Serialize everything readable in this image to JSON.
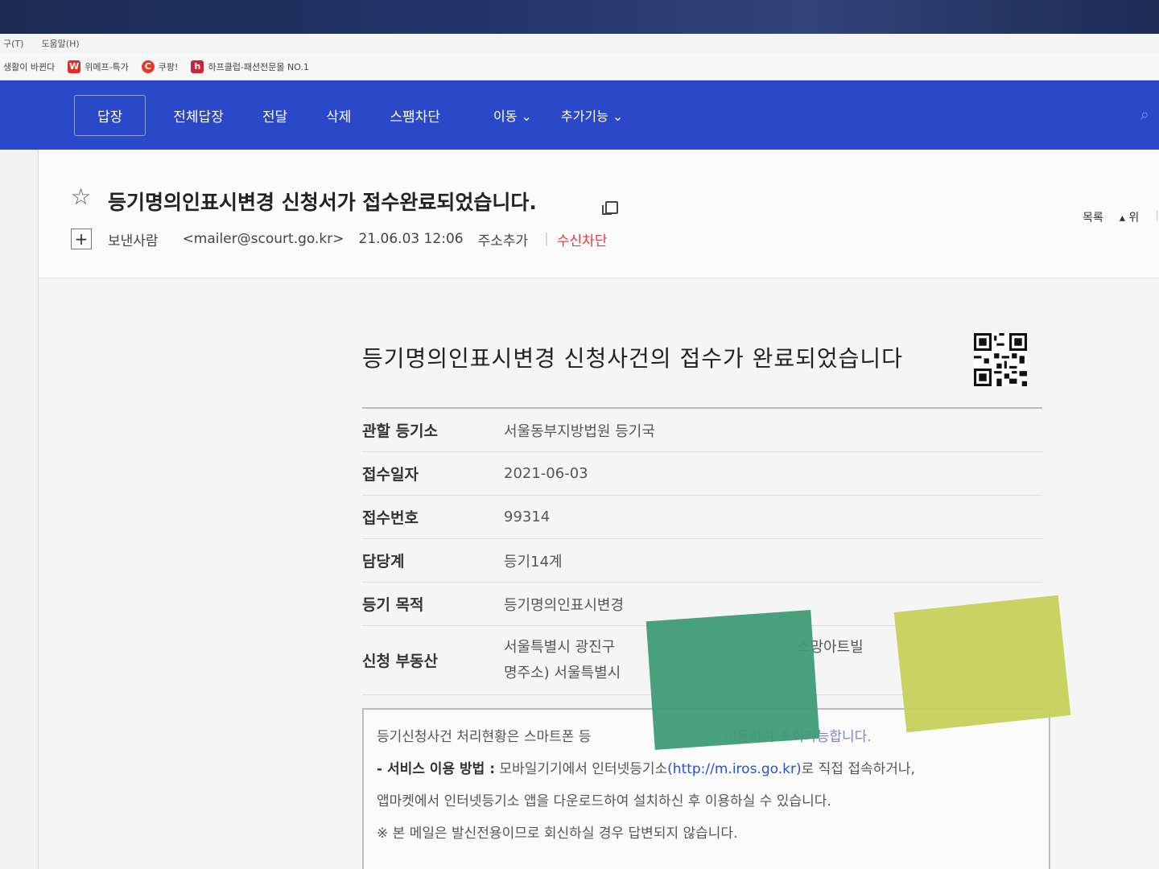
{
  "browser": {
    "menu": [
      "구(T)",
      "도움말(H)"
    ],
    "bookmarks": [
      {
        "icon": "",
        "label": "생활이 바뀐다",
        "color": ""
      },
      {
        "icon": "W",
        "label": "위메프-특가",
        "color": "#e12c2c"
      },
      {
        "icon": "C",
        "label": "쿠팡!",
        "color": "#e23a2a"
      },
      {
        "icon": "h",
        "label": "하프클럽-패션전문몰 NO.1",
        "color": "#c8263c"
      }
    ]
  },
  "toolbar": {
    "reply": "답장",
    "reply_all": "전체답장",
    "forward": "전달",
    "delete": "삭제",
    "spam": "스팸차단",
    "move": "이동 ⌄",
    "more": "추가기능 ⌄"
  },
  "mail": {
    "subject": "등기명의인표시변경 신청서가 접수완료되었습니다.",
    "sender_label": "보낸사람",
    "sender_email": "<mailer@scourt.go.kr>",
    "date": "21.06.03 12:06",
    "add_contact": "주소추가",
    "block": "수신차단",
    "list_link": "목록",
    "up_link": "▴ 위"
  },
  "body": {
    "title": "등기명의인표시변경 신청사건의 접수가 완료되었습니다",
    "rows": [
      {
        "label": "관할 등기소",
        "value": "서울동부지방법원 등기국"
      },
      {
        "label": "접수일자",
        "value": "2021-06-03"
      },
      {
        "label": "접수번호",
        "value": "99314"
      },
      {
        "label": "담당계",
        "value": "등기14계"
      },
      {
        "label": "등기 목적",
        "value": "등기명의인표시변경"
      }
    ],
    "property": {
      "label": "신청 부동산",
      "line1": "서울특별시 광진구",
      "line1_right": "소망아트빌",
      "line2": "명주소) 서울특별시"
    },
    "notice": {
      "line1_a": "등기신청사건 처리현황은 스마트폰 등",
      "line1_b": "이용하여 조회가능합니다.",
      "line2_label": "- 서비스 이용 방법 :",
      "line2_a": "모바일기기에서 인터넷등기소",
      "line2_link": "(http://m.iros.go.kr)",
      "line2_b": "로 직접 접속하거나,",
      "line3": "앱마켓에서 인터넷등기소 앱을 다운로드하여 설치하신 후 이용하실 수 있습니다.",
      "line4": "※ 본 메일은 발신전용이므로 회신하실 경우 답변되지 않습니다."
    }
  },
  "colors": {
    "toolbar": "#2a48c8",
    "block_red": "#e03b3b",
    "sticky_green": "#3f9b78",
    "sticky_yellow": "#c6d05a"
  }
}
